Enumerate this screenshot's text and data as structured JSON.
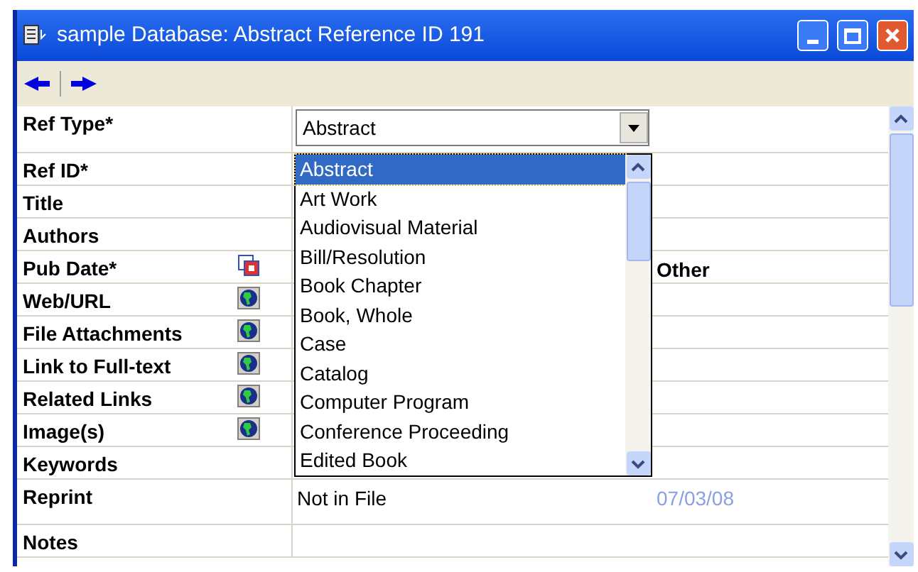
{
  "window": {
    "title": "sample Database: Abstract Reference ID 191"
  },
  "fields": [
    {
      "label": "Ref Type*",
      "kind": "combo"
    },
    {
      "label": "Ref ID*",
      "kind": "plain"
    },
    {
      "label": "Title",
      "kind": "plain"
    },
    {
      "label": "Authors",
      "kind": "plain"
    },
    {
      "label": "Pub Date*",
      "kind": "date",
      "extra": "Other"
    },
    {
      "label": "Web/URL",
      "kind": "link"
    },
    {
      "label": "File Attachments",
      "kind": "link"
    },
    {
      "label": "Link to Full-text",
      "kind": "link"
    },
    {
      "label": "Related Links",
      "kind": "link"
    },
    {
      "label": "Image(s)",
      "kind": "link"
    },
    {
      "label": "Keywords",
      "kind": "plain"
    },
    {
      "label": "Reprint",
      "kind": "reprint",
      "value": "Not in File",
      "date": "07/03/08"
    },
    {
      "label": "Notes",
      "kind": "plain"
    }
  ],
  "ref_type": {
    "value": "Abstract",
    "expanded": true,
    "options": [
      {
        "label": "Abstract",
        "selected": true
      },
      {
        "label": "Art Work",
        "selected": false
      },
      {
        "label": "Audiovisual Material",
        "selected": false
      },
      {
        "label": "Bill/Resolution",
        "selected": false
      },
      {
        "label": "Book Chapter",
        "selected": false
      },
      {
        "label": "Book, Whole",
        "selected": false
      },
      {
        "label": "Case",
        "selected": false
      },
      {
        "label": "Catalog",
        "selected": false
      },
      {
        "label": "Computer Program",
        "selected": false
      },
      {
        "label": "Conference Proceeding",
        "selected": false
      },
      {
        "label": "Edited Book",
        "selected": false
      }
    ]
  }
}
